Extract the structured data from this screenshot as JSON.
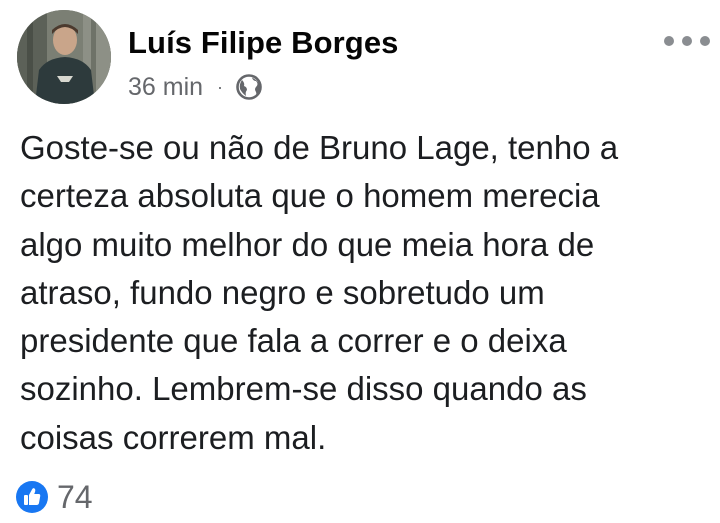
{
  "post": {
    "author": "Luís Filipe Borges",
    "timestamp": "36 min",
    "separator": "·",
    "audience_icon": "globe-icon",
    "menu_icon": "more-options-icon",
    "body_lines": [
      "Goste-se ou não de Bruno Lage, tenho a",
      "certeza absoluta que o homem merecia",
      "algo muito melhor do que meia hora de",
      "atraso, fundo negro e sobretudo um",
      "presidente que fala a correr e o deixa",
      "sozinho. Lembrem-se disso quando as",
      "coisas correrem mal."
    ],
    "reactions": {
      "icon": "like-icon",
      "count": "74"
    }
  },
  "colors": {
    "like_blue": "#1877f2",
    "secondary_text": "#65676b",
    "primary_text": "#1c1e21"
  }
}
